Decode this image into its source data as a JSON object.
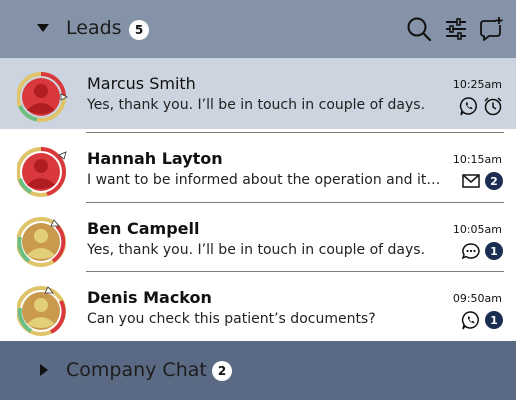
{
  "leads_group": {
    "title": "Leads",
    "count": "5"
  },
  "header_icons": [
    "search-icon",
    "filter-sliders-icon",
    "new-chat-icon"
  ],
  "conversations": [
    {
      "name": "Marcus Smith",
      "message": "Yes, thank you. I’ll be in touch in couple of days.",
      "time": "10:25am",
      "icons": [
        "whatsapp-icon",
        "alarm-clock-icon"
      ],
      "unread": "",
      "selected": true,
      "unread_bold": false
    },
    {
      "name": "Hannah Layton",
      "message": "I want to be informed about the operation and its costs and options",
      "time": "10:15am",
      "icons": [
        "mail-icon"
      ],
      "unread": "2",
      "selected": false,
      "unread_bold": true
    },
    {
      "name": "Ben Campell",
      "message": "Yes, thank you. I’ll be in touch in couple of days.",
      "time": "10:05am",
      "icons": [
        "chat-bubble-icon"
      ],
      "unread": "1",
      "selected": false,
      "unread_bold": true
    },
    {
      "name": "Denis Mackon",
      "message": "Can you check this patient’s documents?",
      "time": "09:50am",
      "icons": [
        "whatsapp-icon"
      ],
      "unread": "1",
      "selected": false,
      "unread_bold": true
    }
  ],
  "company_chat_group": {
    "title": "Company Chat",
    "count": "2"
  },
  "colors": {
    "header_bg": "#8593a8",
    "selected_row_bg": "#ccd4df",
    "footer_bg": "#5a6a84",
    "unread_badge": "#1b2d52",
    "avatar_red": "#d9383c",
    "avatar_tan": "#c99a4e"
  }
}
